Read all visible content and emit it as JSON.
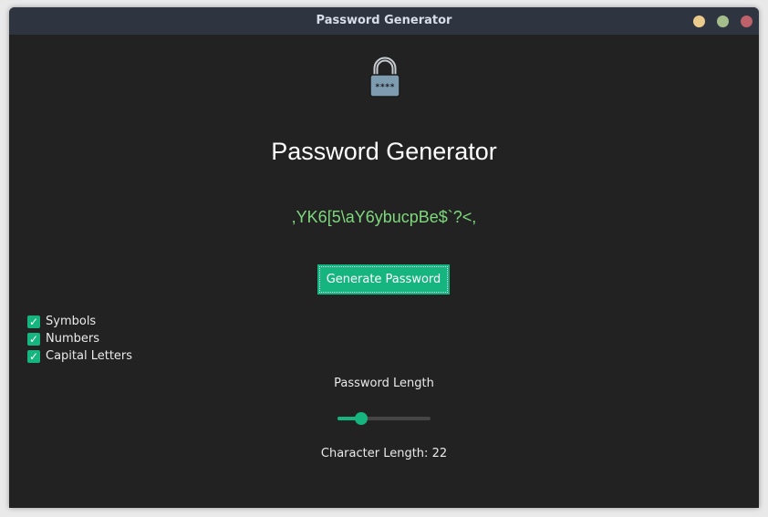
{
  "window": {
    "title": "Password Generator",
    "controls": [
      "minimize",
      "maximize",
      "close"
    ]
  },
  "app": {
    "icon": "padlock-icon",
    "title": "Password Generator",
    "password": ",YK6[5\\aY6ybucpBe$`?<,",
    "generate_button": "Generate Password"
  },
  "options": [
    {
      "label": "Symbols",
      "checked": true
    },
    {
      "label": "Numbers",
      "checked": true
    },
    {
      "label": "Capital Letters",
      "checked": true
    }
  ],
  "length": {
    "label": "Password Length",
    "slider_fraction": 0.25,
    "char_length_prefix": "Character Length: ",
    "value": "22"
  },
  "colors": {
    "accent": "#16b57f",
    "password_text": "#7ed87c",
    "background": "#222223",
    "titlebar": "#2e3440"
  }
}
